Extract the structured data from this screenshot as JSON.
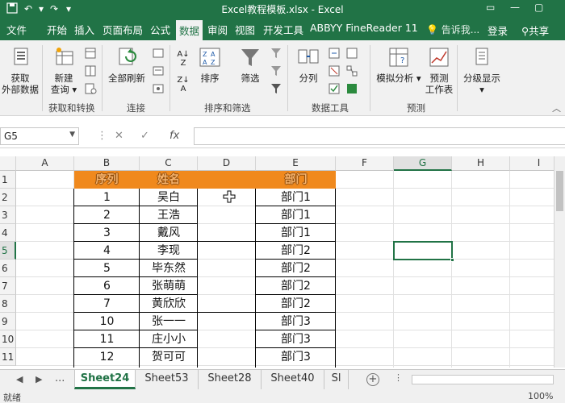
{
  "titlebar": {
    "title": "Excel教程模板.xlsx - Excel",
    "save_icon": "save-icon",
    "undo_icon": "undo-icon",
    "redo_icon": "redo-icon",
    "customize_icon": "chevron-down-icon"
  },
  "tabs": [
    "文件",
    "开始",
    "插入",
    "页面布局",
    "公式",
    "数据",
    "审阅",
    "视图",
    "开发工具",
    "ABBYY FineReader 11"
  ],
  "active_tab": "数据",
  "tell_me": "告诉我...",
  "sign_in": "登录",
  "share": "共享",
  "ribbon": {
    "get_external": "获取\n外部数据",
    "new_query": "新建\n查询",
    "refresh_all": "全部刷新",
    "group_get_transform": "获取和转换",
    "group_connections": "连接",
    "sort": "排序",
    "filter": "筛选",
    "group_sort_filter": "排序和筛选",
    "text_to_columns": "分列",
    "group_data_tools": "数据工具",
    "what_if": "模拟分析",
    "forecast_sheet": "预测\n工作表",
    "group_forecast": "预测",
    "outline": "分级显示"
  },
  "namebox": "G5",
  "fx_label": "fx",
  "columns": [
    "A",
    "B",
    "C",
    "D",
    "E",
    "F",
    "G",
    "H",
    "I"
  ],
  "selected_column": "G",
  "rows": [
    "1",
    "2",
    "3",
    "4",
    "5",
    "6",
    "7",
    "8",
    "9",
    "10",
    "11"
  ],
  "selected_row": "5",
  "table": {
    "headers": [
      "序列",
      "姓名",
      "部门"
    ],
    "rows": [
      {
        "seq": "1",
        "name": "吴白",
        "dept": "部门1"
      },
      {
        "seq": "2",
        "name": "王浩",
        "dept": "部门1"
      },
      {
        "seq": "3",
        "name": "戴风",
        "dept": "部门1"
      },
      {
        "seq": "4",
        "name": "李现",
        "dept": "部门2"
      },
      {
        "seq": "5",
        "name": "毕东然",
        "dept": "部门2"
      },
      {
        "seq": "6",
        "name": "张萌萌",
        "dept": "部门2"
      },
      {
        "seq": "7",
        "name": "黄欣欣",
        "dept": "部门2"
      },
      {
        "seq": "10",
        "name": "张一一",
        "dept": "部门3"
      },
      {
        "seq": "11",
        "name": "庄小小",
        "dept": "部门3"
      },
      {
        "seq": "12",
        "name": "贺可可",
        "dept": "部门3"
      }
    ]
  },
  "sheets": [
    "Sheet24",
    "Sheet53",
    "Sheet28",
    "Sheet40",
    "Sl"
  ],
  "active_sheet": "Sheet24",
  "sheet_ellipsis": "...",
  "status": {
    "ready": "就绪",
    "zoom": "100%"
  }
}
